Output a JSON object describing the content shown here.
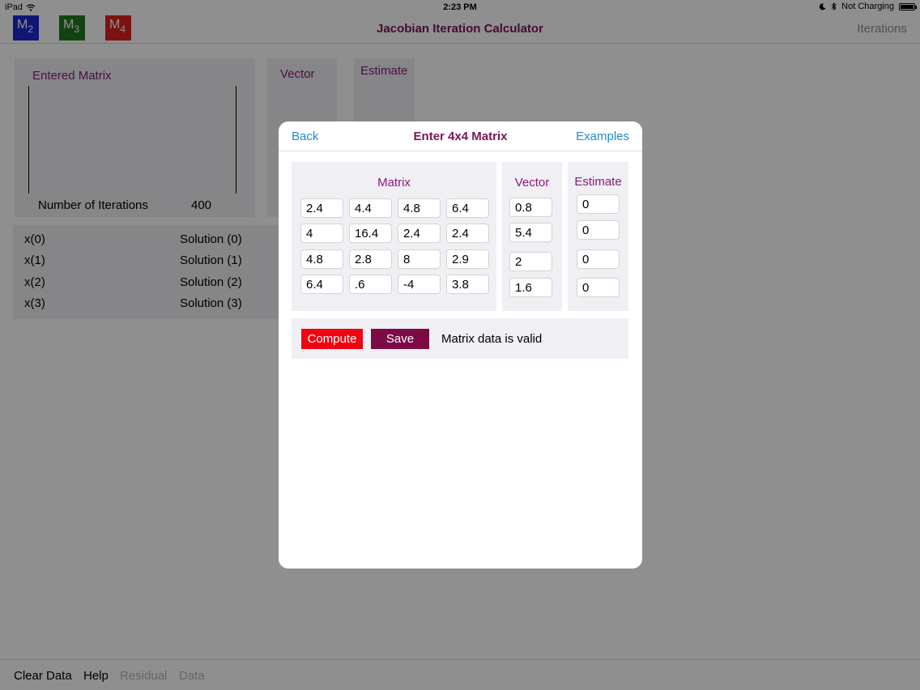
{
  "colors": {
    "accent_title": "#7b1454",
    "accent_label": "#8b1a7a",
    "link_blue": "#1f8ad1",
    "m2": "#1b2ad1",
    "m3": "#1f7a1f",
    "m4": "#d9221d",
    "compute": "#f0030f",
    "save": "#7b0a45"
  },
  "statusbar": {
    "device": "iPad",
    "time": "2:23 PM",
    "charging": "Not Charging",
    "icons": [
      "wifi-icon",
      "moon-icon",
      "bluetooth-icon",
      "battery-icon"
    ]
  },
  "navbar": {
    "matrix_buttons": [
      {
        "letter": "M",
        "sub": "2"
      },
      {
        "letter": "M",
        "sub": "3"
      },
      {
        "letter": "M",
        "sub": "4"
      }
    ],
    "title": "Jacobian Iteration Calculator",
    "right_label": "Iterations"
  },
  "main": {
    "entered_matrix_label": "Entered Matrix",
    "vector_label": "Vector",
    "estimate_label": "Estimate",
    "iterations_label": "Number of Iterations",
    "iterations_value": "400",
    "results": [
      {
        "x": "x(0)",
        "solution": "Solution (0)"
      },
      {
        "x": "x(1)",
        "solution": "Solution (1)"
      },
      {
        "x": "x(2)",
        "solution": "Solution (2)"
      },
      {
        "x": "x(3)",
        "solution": "Solution (3)"
      }
    ]
  },
  "bottombar": {
    "clear": "Clear Data",
    "help": "Help",
    "residual": "Residual",
    "data": "Data"
  },
  "modal": {
    "back": "Back",
    "title": "Enter 4x4 Matrix",
    "examples": "Examples",
    "matrix_label": "Matrix",
    "vector_label": "Vector",
    "estimate_label": "Estimate",
    "matrix": [
      [
        "2.4",
        "4.4",
        "4.8",
        "6.4"
      ],
      [
        "4",
        "16.4",
        "2.4",
        "2.4"
      ],
      [
        "4.8",
        "2.8",
        "8",
        "2.9"
      ],
      [
        "6.4",
        ".6",
        "-4",
        "3.8"
      ]
    ],
    "vector": [
      "0.8",
      "5.4",
      "2",
      "1.6"
    ],
    "estimate": [
      "0",
      "0",
      "0",
      "0"
    ],
    "compute": "Compute",
    "save": "Save",
    "status": "Matrix data is valid"
  }
}
